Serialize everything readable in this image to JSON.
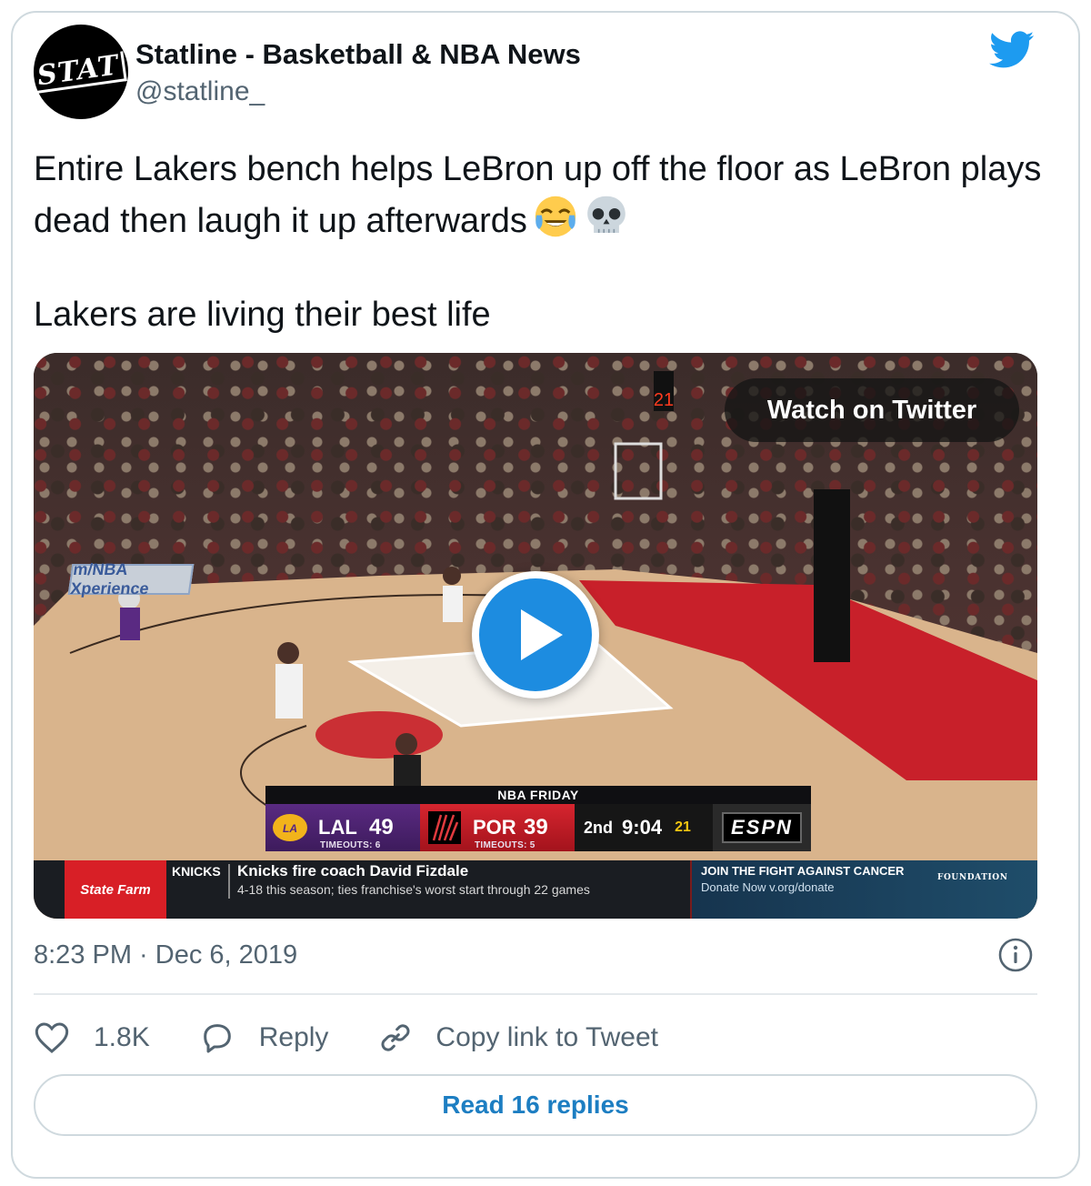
{
  "author": {
    "avatar_text": "STAT",
    "name": "Statline - Basketball & NBA News",
    "handle": "@statline_"
  },
  "tweet": {
    "line1": "Entire Lakers bench helps LeBron up off the floor as LeBron plays dead then laugh it up afterwards",
    "emojis": [
      "tears-of-joy-emoji",
      "skull-emoji"
    ],
    "line2": "Lakers are living their best life"
  },
  "video": {
    "watch_label": "Watch on Twitter",
    "court_sign": "m/NBA Xperience",
    "scoreboard": {
      "title": "NBA FRIDAY",
      "home": {
        "abbr": "LAL",
        "score": "49",
        "timeouts": "TIMEOUTS: 6",
        "color": "#552583"
      },
      "away": {
        "abbr": "POR",
        "score": "39",
        "timeouts": "TIMEOUTS: 5",
        "color": "#e03a3e"
      },
      "period": "2nd",
      "clock": "9:04",
      "shot_clock": "21",
      "network": "ESPN"
    },
    "ticker": {
      "sponsor": "State Farm",
      "tag": "KNICKS",
      "headline": "Knicks fire coach David Fizdale",
      "subline": "4-18 this season; ties franchise's worst start through 22 games",
      "promo_line1": "JOIN THE FIGHT AGAINST CANCER",
      "promo_line2": "Donate Now v.org/donate",
      "promo_brand": "FOUNDATION"
    }
  },
  "meta": {
    "timestamp": "8:23 PM · Dec 6, 2019"
  },
  "actions": {
    "like_count": "1.8K",
    "reply_label": "Reply",
    "copy_label": "Copy link to Tweet"
  },
  "read_replies_label": "Read 16 replies",
  "colors": {
    "twitter_blue": "#1d9bf0",
    "link_blue": "#1d7ec2",
    "secondary_text": "#536471",
    "border": "#cfd9de"
  }
}
